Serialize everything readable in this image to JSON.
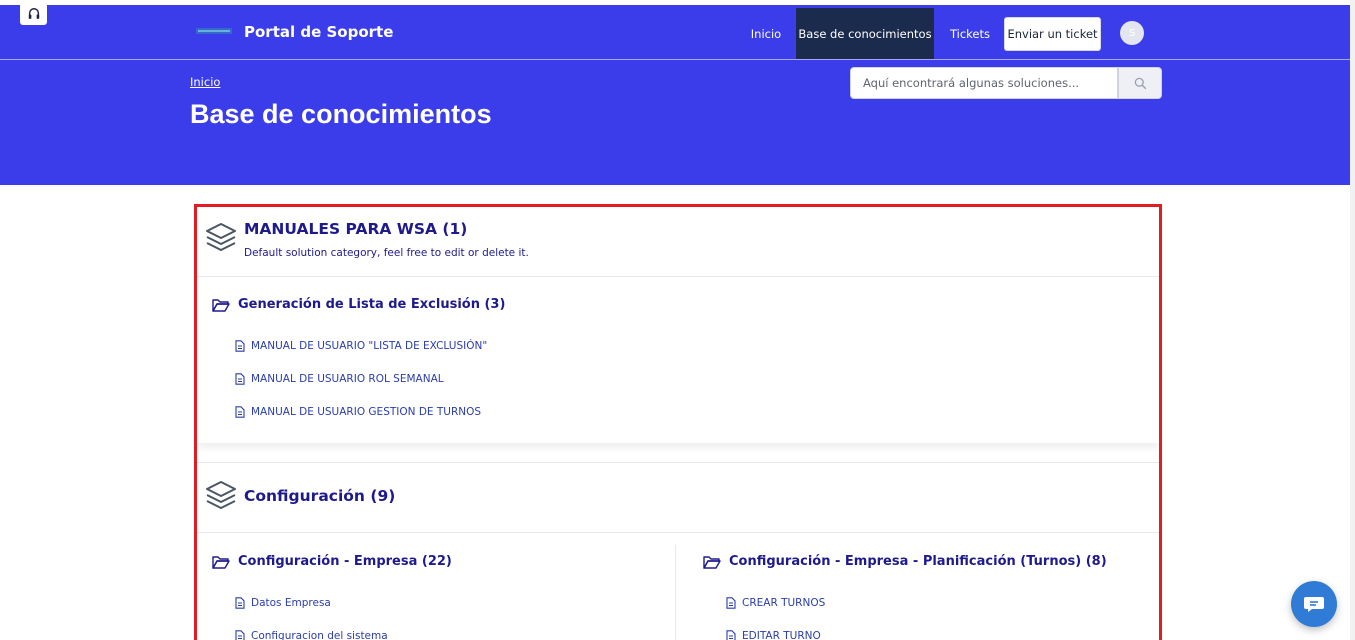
{
  "header": {
    "brand": "Portal de Soporte",
    "nav": {
      "inicio": "Inicio",
      "knowledge_base": "Base de conocimientos",
      "tickets": "Tickets",
      "submit_ticket": "Enviar un ticket"
    },
    "avatar_initial": "S"
  },
  "hero": {
    "breadcrumb": "Inicio",
    "title": "Base de conocimientos",
    "search_placeholder": "Aquí encontrará algunas soluciones..."
  },
  "categories": [
    {
      "title": "MANUALES PARA WSA (1)",
      "description": "Default solution category, feel free to edit or delete it.",
      "folders": [
        {
          "name": "Generación de Lista de Exclusión (3)",
          "articles": [
            "MANUAL DE USUARIO \"LISTA DE EXCLUSIÓN\"",
            "MANUAL DE USUARIO ROL SEMANAL",
            "MANUAL DE USUARIO GESTION DE TURNOS"
          ]
        }
      ]
    },
    {
      "title": "Configuración (9)",
      "folders": [
        {
          "name": "Configuración - Empresa (22)",
          "articles": [
            "Datos Empresa",
            "Configuracion del sistema"
          ]
        },
        {
          "name": "Configuración - Empresa - Planificación (Turnos) (8)",
          "articles": [
            "CREAR TURNOS",
            "EDITAR TURNO"
          ]
        }
      ]
    }
  ],
  "colors": {
    "hero_bg": "#3b3deb",
    "nav_active_bg": "#1a2b4e",
    "category_text": "#1e1a8c",
    "article_link": "#2a3dab",
    "highlight_border": "#e31c23",
    "chat_button": "#2f7bd6"
  },
  "icons": {
    "headset": "headset-icon",
    "search": "search-icon",
    "category": "layers-icon",
    "folder": "folder-open-icon",
    "article": "document-icon",
    "chat": "chat-icon"
  }
}
